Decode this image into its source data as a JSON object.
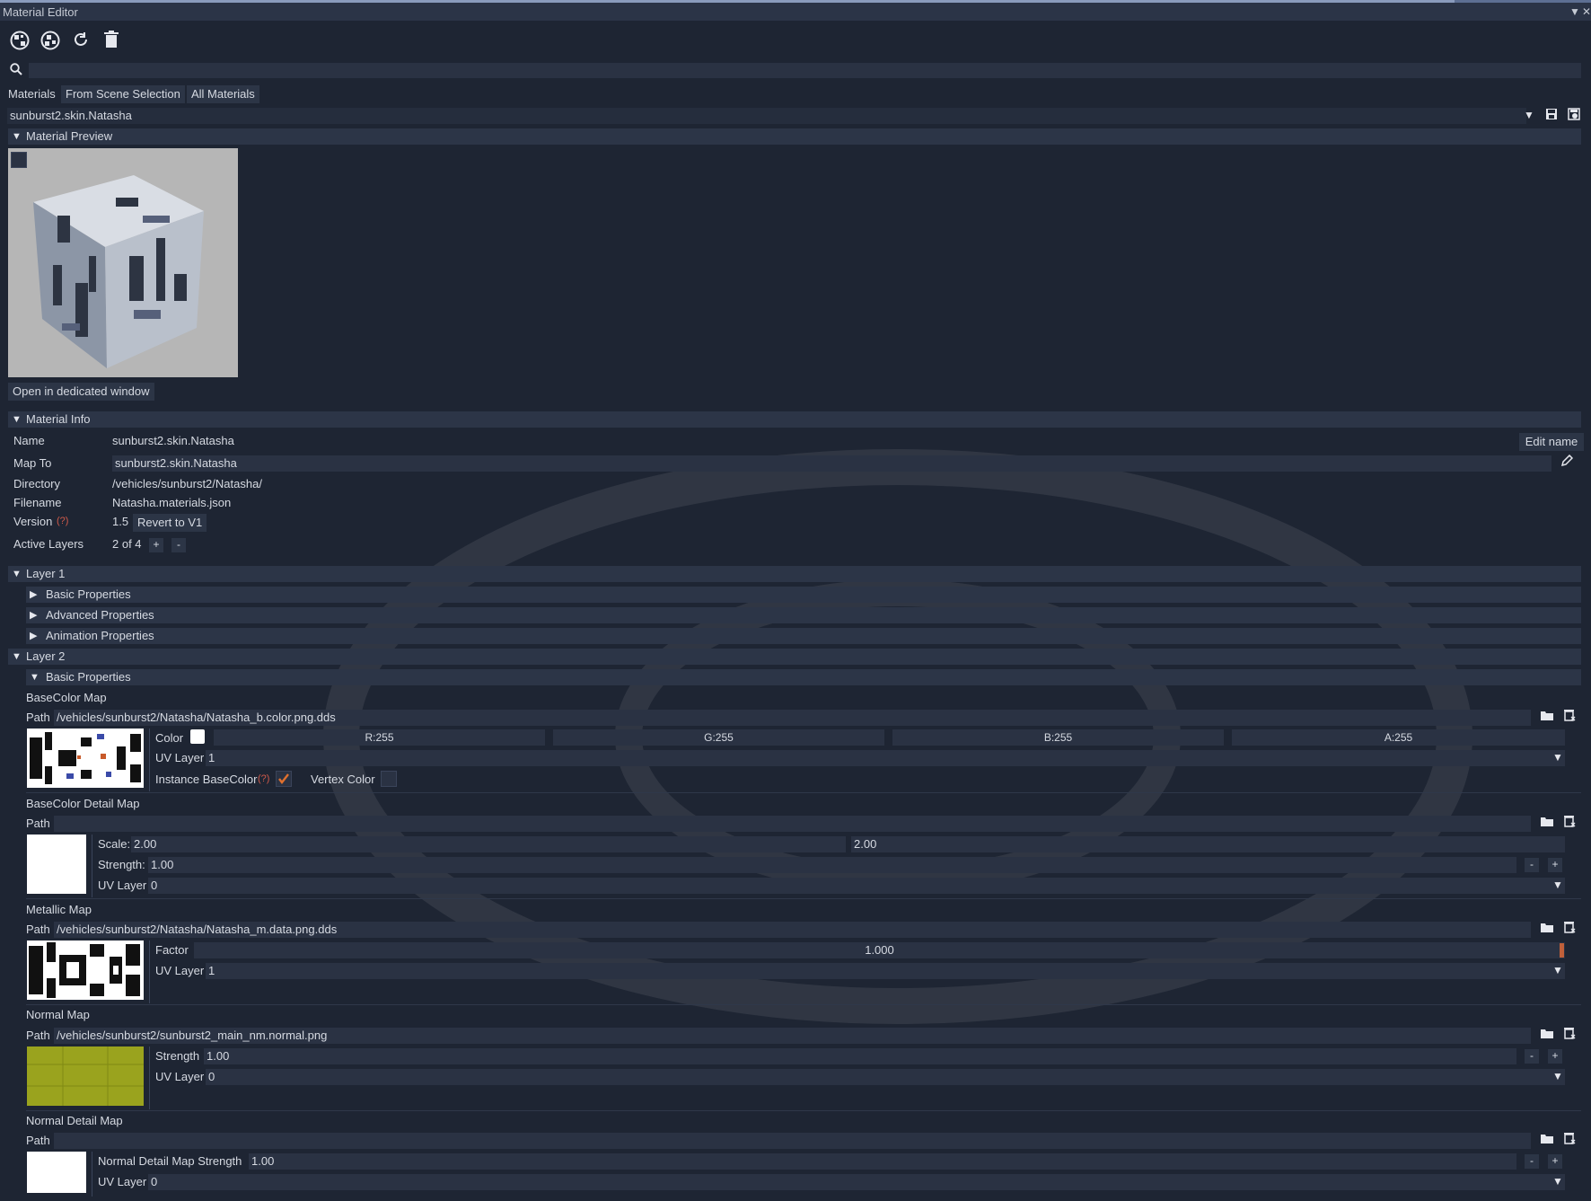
{
  "window": {
    "title": "Material Editor"
  },
  "toolbar": {
    "icons": [
      "sphere-checker-icon",
      "sphere-checker-alt-icon",
      "refresh-icon",
      "trash-icon"
    ]
  },
  "search": {
    "placeholder": ""
  },
  "tabs": {
    "label": "Materials",
    "from_scene": "From Scene Selection",
    "all": "All Materials"
  },
  "material_select": {
    "value": "sunburst2.skin.Natasha"
  },
  "preview": {
    "header": "Material Preview",
    "open_window": "Open in dedicated window"
  },
  "info": {
    "header": "Material Info",
    "name_label": "Name",
    "name_value": "sunburst2.skin.Natasha",
    "edit_name": "Edit name",
    "mapto_label": "Map To",
    "mapto_value": "sunburst2.skin.Natasha",
    "dir_label": "Directory",
    "dir_value": "/vehicles/sunburst2/Natasha/",
    "file_label": "Filename",
    "file_value": "Natasha.materials.json",
    "version_label": "Version",
    "help": "(?)",
    "version_value": "1.5",
    "revert": "Revert to V1",
    "layers_label": "Active Layers",
    "layers_value": "2 of 4",
    "plus": "+",
    "minus": "-"
  },
  "layer1": {
    "header": "Layer 1",
    "basic": "Basic Properties",
    "advanced": "Advanced Properties",
    "animation": "Animation Properties"
  },
  "layer2": {
    "header": "Layer 2",
    "basic": "Basic Properties",
    "basecolor": {
      "title": "BaseColor Map",
      "path_label": "Path",
      "path": "/vehicles/sunburst2/Natasha/Natasha_b.color.png.dds",
      "color_label": "Color",
      "r": "R:255",
      "g": "G:255",
      "b": "B:255",
      "a": "A:255",
      "uv_label": "UV Layer",
      "uv_value": "1",
      "instance_label": "Instance BaseColor",
      "help": "(?)",
      "vertex_label": "Vertex Color"
    },
    "basecolor_detail": {
      "title": "BaseColor Detail Map",
      "path_label": "Path",
      "path": "",
      "scale_label": "Scale:",
      "scale_x": "2.00",
      "scale_y": "2.00",
      "strength_label": "Strength:",
      "strength_value": "1.00",
      "uv_label": "UV Layer",
      "uv_value": "0"
    },
    "metallic": {
      "title": "Metallic Map",
      "path_label": "Path",
      "path": "/vehicles/sunburst2/Natasha/Natasha_m.data.png.dds",
      "factor_label": "Factor",
      "factor_value": "1.000",
      "uv_label": "UV Layer",
      "uv_value": "1"
    },
    "normal": {
      "title": "Normal Map",
      "path_label": "Path",
      "path": "/vehicles/sunburst2/sunburst2_main_nm.normal.png",
      "strength_label": "Strength",
      "strength_value": "1.00",
      "uv_label": "UV Layer",
      "uv_value": "0"
    },
    "normal_detail": {
      "title": "Normal Detail Map",
      "path_label": "Path",
      "path": "",
      "strength_label": "Normal Detail Map Strength",
      "strength_value": "1.00",
      "uv_label": "UV Layer",
      "uv_value": "0"
    }
  },
  "colors": {
    "accent_check": "#e0702e",
    "slider_grab": "#c0603a",
    "normal_thumb": "#9aa31e"
  }
}
